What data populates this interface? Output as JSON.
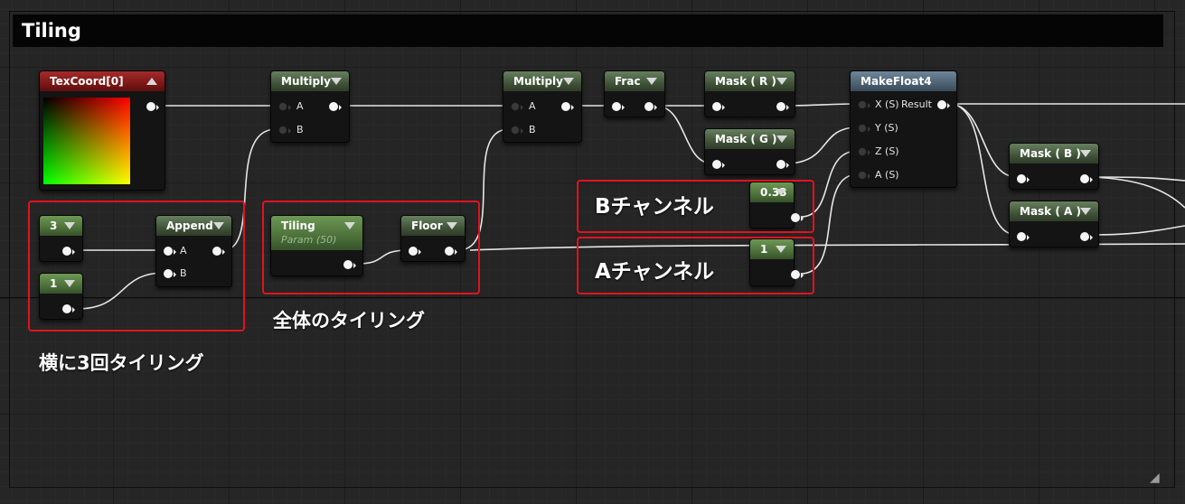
{
  "comment": {
    "title": "Tiling"
  },
  "colors": {
    "wire": "#e6e6e6",
    "annotation_box": "#e2121f",
    "header_green": "#3e5036",
    "header_constant_green": "#4a6d38",
    "header_red": "#7a1616",
    "header_blue": "#4a5f70",
    "node_body": "#141414",
    "canvas": "#262626"
  },
  "nodes": {
    "texcoord": {
      "title": "TexCoord[0]"
    },
    "const3": {
      "title": "3"
    },
    "const1a": {
      "title": "1"
    },
    "append": {
      "title": "Append",
      "pin_a": "A",
      "pin_b": "B"
    },
    "multiply1": {
      "title": "Multiply",
      "pin_a": "A",
      "pin_b": "B"
    },
    "tiling": {
      "title": "Tiling",
      "subtitle": "Param (50)"
    },
    "floor": {
      "title": "Floor"
    },
    "multiply2": {
      "title": "Multiply",
      "pin_a": "A",
      "pin_b": "B"
    },
    "frac": {
      "title": "Frac"
    },
    "mask_r": {
      "title": "Mask ( R )"
    },
    "mask_g": {
      "title": "Mask ( G )"
    },
    "const033": {
      "title": "0.33"
    },
    "const1b": {
      "title": "1"
    },
    "makefloat4": {
      "title": "MakeFloat4",
      "pin_x": "X (S)",
      "pin_y": "Y (S)",
      "pin_z": "Z (S)",
      "pin_a": "A (S)",
      "result": "Result"
    },
    "mask_b": {
      "title": "Mask ( B )"
    },
    "mask_a": {
      "title": "Mask ( A )"
    }
  },
  "annotations": {
    "horizontal_tiling": "横に3回タイリング",
    "overall_tiling": "全体のタイリング",
    "b_channel": "Bチャンネル",
    "a_channel": "Aチャンネル"
  },
  "icons": {
    "collapse_arrow": "chevron-down-icon",
    "preview_toggle": "chevron-up-icon",
    "resize": "resize-grip-icon"
  }
}
